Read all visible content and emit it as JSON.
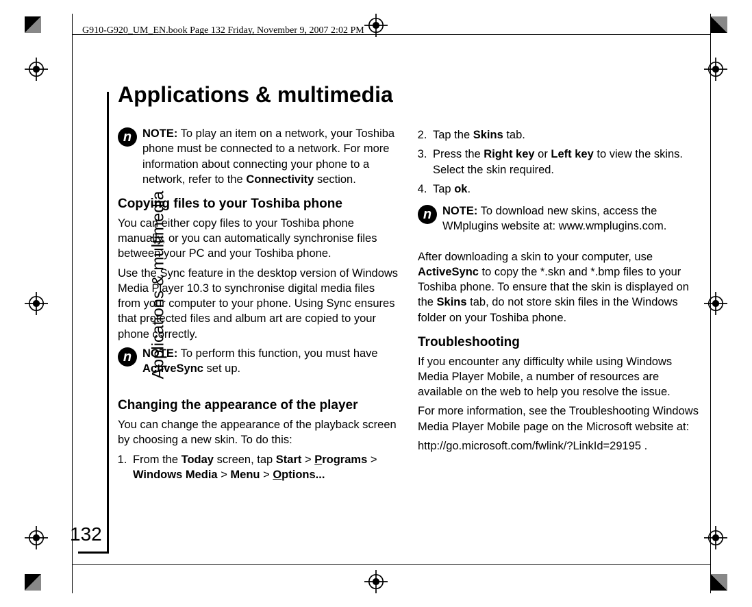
{
  "header_info": "G910-G920_UM_EN.book  Page 132  Friday, November 9, 2007  2:02 PM",
  "side_label": "Applications & multimedia",
  "page_number": "132",
  "title": "Applications & multimedia",
  "note_icon_label": "n",
  "col1": {
    "note1": {
      "label": "NOTE:",
      "text_a": " To play an item on a network, your Toshiba phone must be connected to a network. For more information about connecting your phone to a network, refer to the ",
      "bold1": "Connectivity",
      "text_b": " section."
    },
    "h_copy": "Copying files to your Toshiba phone",
    "p_copy1": "You can either copy files to your Toshiba phone manually, or you can automatically synchronise files between your PC and your Toshiba phone.",
    "p_copy2": "Use the Sync feature in the desktop version of Windows Media Player 10.3 to synchronise digital media files from your computer to your phone. Using Sync ensures that protected files and album art are copied to your phone correctly.",
    "note2": {
      "label": "NOTE:",
      "text_a": " To perform this function, you must have ",
      "bold1": "ActiveSync",
      "text_b": " set up."
    },
    "h_change": "Changing the appearance of the player",
    "p_change": "You can change the appearance of the playback screen by choosing a new skin. To do this:",
    "step1": {
      "a": "From the ",
      "b1": "Today",
      "b": " screen, tap ",
      "b2": "Start",
      "c": " > ",
      "b3u": "P",
      "b3": "rograms",
      "d": " > ",
      "b4": "Windows Media",
      "e": " > ",
      "b5": "Menu",
      "f": " > ",
      "b6u": "O",
      "b6": "ptions..."
    }
  },
  "col2": {
    "step2": {
      "a": "Tap the ",
      "b1": "Skins",
      "b": " tab."
    },
    "step3": {
      "a": "Press the ",
      "b1": "Right key",
      "b": " or ",
      "b2": "Left key",
      "c": " to view the skins. Select the skin required."
    },
    "step4": {
      "a": "Tap ",
      "b1": "ok",
      "b": "."
    },
    "note1": {
      "label": "NOTE:",
      "text": " To download new skins, access the WMplugins website at: www.wmplugins.com."
    },
    "p_after": {
      "a": "After downloading a skin to your computer, use ",
      "b1": "ActiveSync",
      "b": " to copy the *.skn and *.bmp files to your Toshiba phone. To ensure that the skin is displayed on the ",
      "b2": "Skins",
      "c": " tab, do not store skin files in the Windows folder on your Toshiba phone."
    },
    "h_trouble": "Troubleshooting",
    "p_t1": "If you encounter any difficulty while using Windows Media Player Mobile, a number of resources are available on the web to help you resolve the issue.",
    "p_t2": "For more information, see the Troubleshooting Windows Media Player Mobile page on the Microsoft website at:",
    "p_t3": "http://go.microsoft.com/fwlink/?LinkId=29195 ."
  }
}
